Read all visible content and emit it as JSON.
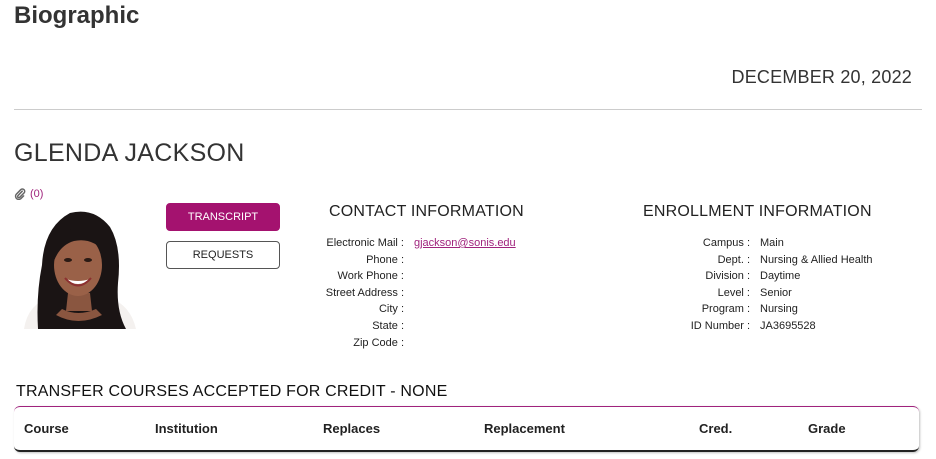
{
  "header": {
    "title": "Biographic",
    "date": "DECEMBER 20, 2022"
  },
  "student": {
    "name": "GLENDA JACKSON",
    "attachment_count": "(0)"
  },
  "buttons": {
    "transcript": "TRANSCRIPT",
    "requests": "REQUESTS"
  },
  "contact": {
    "heading": "CONTACT INFORMATION",
    "fields": [
      {
        "label": "Electronic Mail :",
        "value": "gjackson@sonis.edu"
      },
      {
        "label": "Phone :",
        "value": ""
      },
      {
        "label": "Work Phone :",
        "value": ""
      },
      {
        "label": "Street Address :",
        "value": ""
      },
      {
        "label": "City :",
        "value": ""
      },
      {
        "label": "State :",
        "value": ""
      },
      {
        "label": "Zip Code :",
        "value": ""
      }
    ]
  },
  "enrollment": {
    "heading": "ENROLLMENT INFORMATION",
    "fields": [
      {
        "label": "Campus :",
        "value": "Main"
      },
      {
        "label": "Dept. :",
        "value": "Nursing & Allied Health"
      },
      {
        "label": "Division :",
        "value": "Daytime"
      },
      {
        "label": "Level :",
        "value": "Senior"
      },
      {
        "label": "Program :",
        "value": "Nursing"
      },
      {
        "label": "ID Number :",
        "value": "JA3695528"
      }
    ]
  },
  "transfer": {
    "heading": "TRANSFER COURSES ACCEPTED FOR CREDIT - NONE",
    "columns": [
      "Course",
      "Institution",
      "Replaces",
      "Replacement",
      "Cred.",
      "Grade"
    ]
  },
  "colors": {
    "accent": "#a4126f",
    "link": "#a0237d",
    "text": "#333333"
  },
  "icons": {
    "attachment": "paperclip-icon"
  }
}
